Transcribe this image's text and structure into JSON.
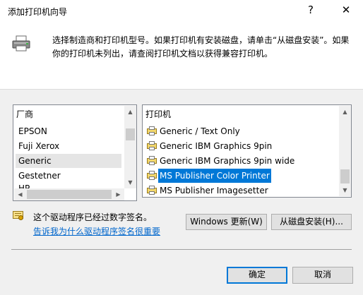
{
  "window": {
    "title": "添加打印机向导",
    "help_glyph": "?",
    "close_glyph": "✕"
  },
  "header": {
    "icon": "printer-icon",
    "instructions": "选择制造商和打印机型号。如果打印机有安装磁盘，请单击“从磁盘安装”。如果你的打印机未列出，请查阅打印机文档以获得兼容打印机。"
  },
  "manufacturers": {
    "column_header": "厂商",
    "items": [
      "EPSON",
      "Fuji Xerox",
      "Generic",
      "Gestetner",
      "HP"
    ],
    "selected_index": 2
  },
  "printers": {
    "column_header": "打印机",
    "items": [
      "Generic / Text Only",
      "Generic IBM Graphics 9pin",
      "Generic IBM Graphics 9pin wide",
      "MS Publisher Color Printer",
      "MS Publisher Imagesetter"
    ],
    "selected_index": 3
  },
  "signature": {
    "status": "这个驱动程序已经过数字签名。",
    "link": "告诉我为什么驱动程序签名很重要"
  },
  "buttons": {
    "windows_update": "Windows 更新(W)",
    "have_disk": "从磁盘安装(H)...",
    "ok": "确定",
    "cancel": "取消"
  },
  "colors": {
    "selection": "#0078d7",
    "link": "#0066cc",
    "background": "#f0f0f0"
  }
}
